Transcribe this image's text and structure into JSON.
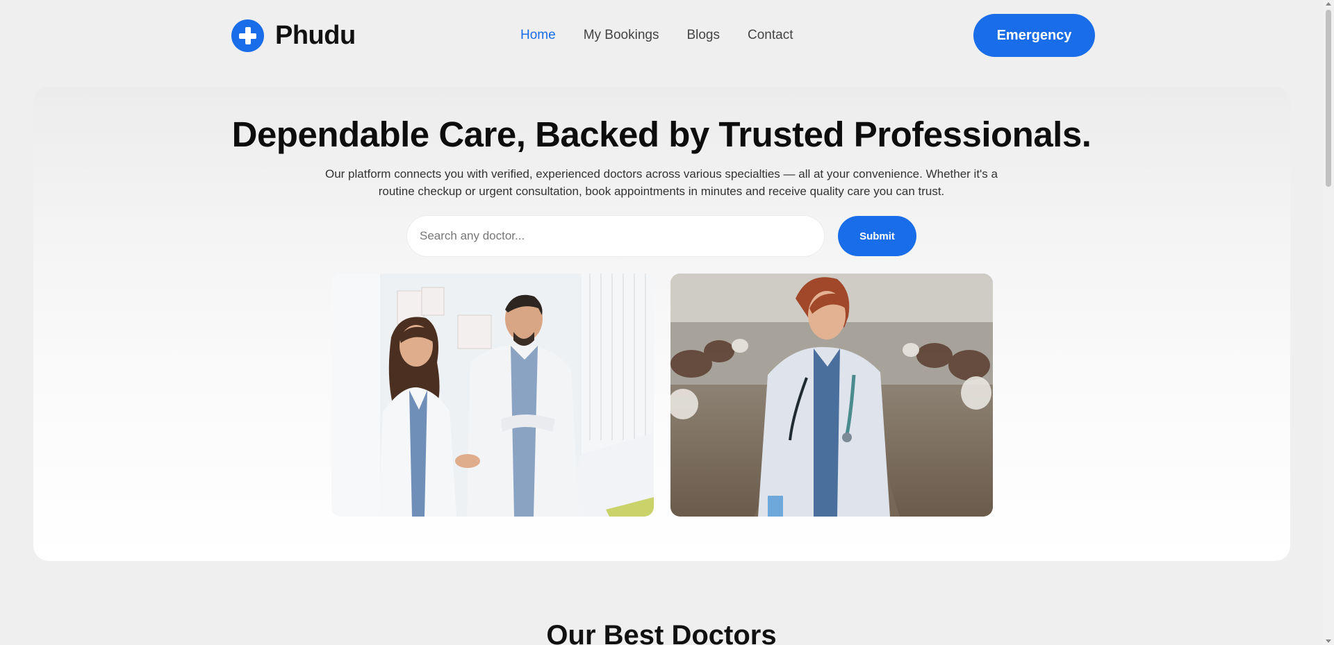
{
  "brand": {
    "name": "Phudu",
    "logo_icon": "plus-circle-icon",
    "accent_color": "#1a6de8"
  },
  "nav": {
    "items": [
      {
        "label": "Home",
        "active": true
      },
      {
        "label": "My Bookings",
        "active": false
      },
      {
        "label": "Blogs",
        "active": false
      },
      {
        "label": "Contact",
        "active": false
      }
    ],
    "emergency_label": "Emergency"
  },
  "hero": {
    "title": "Dependable Care, Backed by Trusted Professionals.",
    "subtitle": "Our platform connects you with verified, experienced doctors across various specialties — all at your convenience. Whether it's a routine checkup or urgent consultation, book appointments in minutes and receive quality care you can trust.",
    "search": {
      "placeholder": "Search any doctor...",
      "value": ""
    },
    "submit_label": "Submit"
  },
  "section": {
    "title": "Our Best Doctors"
  }
}
